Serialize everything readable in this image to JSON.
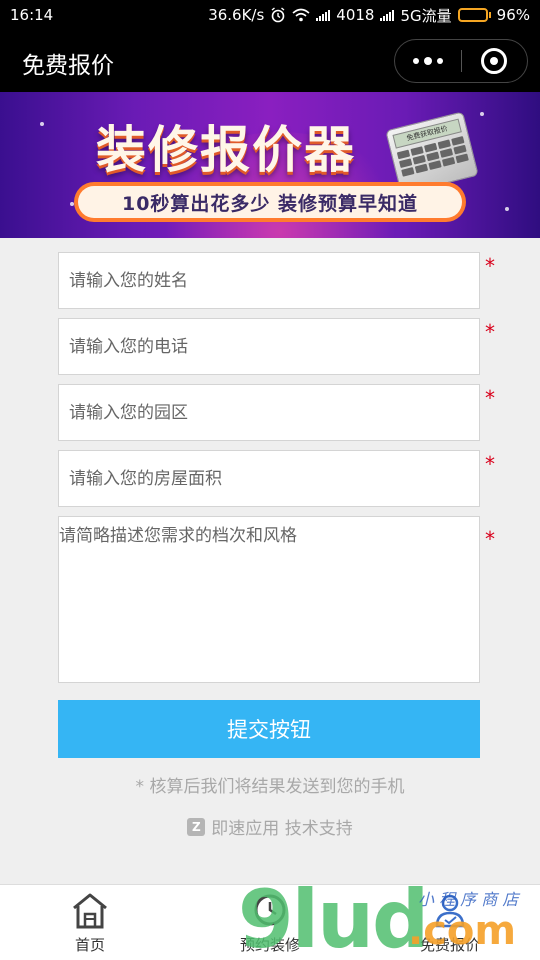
{
  "status_bar": {
    "time": "16:14",
    "speed": "36.6K/s",
    "carrier1": "4018",
    "carrier2": "5G流量",
    "battery": "96%",
    "battery_level": 0.96,
    "icons": [
      "alarm-icon",
      "wifi-icon",
      "signal-icon",
      "battery-icon"
    ]
  },
  "nav": {
    "title": "免费报价",
    "menu_icon": "more-dots-icon",
    "close_icon": "target-circle-icon"
  },
  "banner": {
    "title": "装修报价器",
    "tagline": "10秒算出花多少  装修预算早知道",
    "calculator_screen": "免费获取报价"
  },
  "form": {
    "name_placeholder": "请输入您的姓名",
    "phone_placeholder": "请输入您的电话",
    "park_placeholder": "请输入您的园区",
    "area_placeholder": "请输入您的房屋面积",
    "desc_placeholder": "请简略描述您需求的档次和风格",
    "required_mark": "*",
    "submit_label": "提交按钮",
    "hint": "* 核算后我们将结果发送到您的手机",
    "support": "即速应用 技术支持",
    "support_logo": "Z",
    "accent_color": "#35b5f4",
    "required_color": "#d9001b"
  },
  "tabs": [
    {
      "label": "首页",
      "icon": "home-icon"
    },
    {
      "label": "预约装修",
      "icon": "appointment-icon"
    },
    {
      "label": "免费报价",
      "icon": "quote-icon"
    }
  ],
  "watermark": {
    "text": "9lud",
    "suffix": ".com",
    "script": "小 程 序 商 店"
  }
}
